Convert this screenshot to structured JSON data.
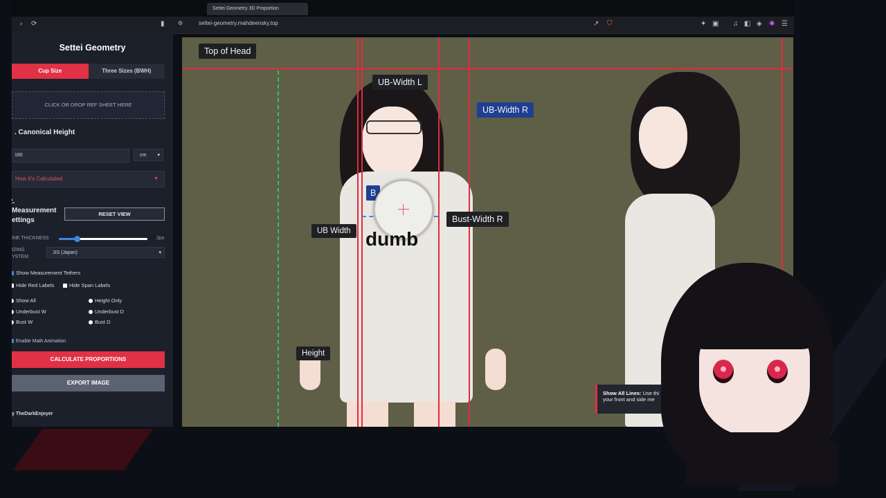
{
  "browser": {
    "url": "settei-geometry.mahdeensky.top",
    "active_tab": "Settei Geometry 3D Proportion"
  },
  "sidebar": {
    "title": "Settei Geometry",
    "mode_tabs": [
      "Cup Size",
      "Three Sizes (BWH)"
    ],
    "drop_zone": "CLICK OR DROP REF SHEET HERE",
    "section1_title": ". Canonical Height",
    "height_value": "160",
    "height_unit": "cm",
    "details_label": "How It's Calculated",
    "section2_number": "2.",
    "section2_title_line1": "Measurement",
    "section2_title_line2": "ettings",
    "reset_button": "RESET VIEW",
    "line_thickness_label": "INE THICKNESS",
    "line_thickness_value": "2px",
    "line_thickness_level": 0.2,
    "sizing_label_1": "IZING",
    "sizing_label_2": "YSTEM",
    "sizing_value": "JIS (Japan)",
    "show_tethers": "Show Measurement Tethers",
    "hide_red": "Hide Red Labels",
    "hide_span": "Hide Span Labels",
    "radios": [
      "Show All",
      "Height Only",
      "Underbust W",
      "Underbust D",
      "Bust W",
      "Bust D"
    ],
    "math_anim": "Enable Math Animation",
    "calc_button": "CALCULATE PROPORTIONS",
    "export_button": "EXPORT IMAGE",
    "credit": "y TheDarkEnjoyer"
  },
  "canvas": {
    "labels": {
      "top_of_head": "Top of Head",
      "ub_width_l": "UB-Width L",
      "ub_width_r": "UB-Width R",
      "bust_width_r": "Bust-Width R",
      "ub_width": "UB Width",
      "height": "Height",
      "partial_b": "B"
    },
    "overlay_text": "dumb",
    "tooltip_title": "Show All Lines:",
    "tooltip_line1": "Use thi",
    "tooltip_line2": "your front and side me"
  },
  "colors": {
    "accent": "#e03145",
    "line": "#e8283c",
    "canvas_bg": "#5e5f46",
    "sidebar_bg": "#1b202b"
  }
}
